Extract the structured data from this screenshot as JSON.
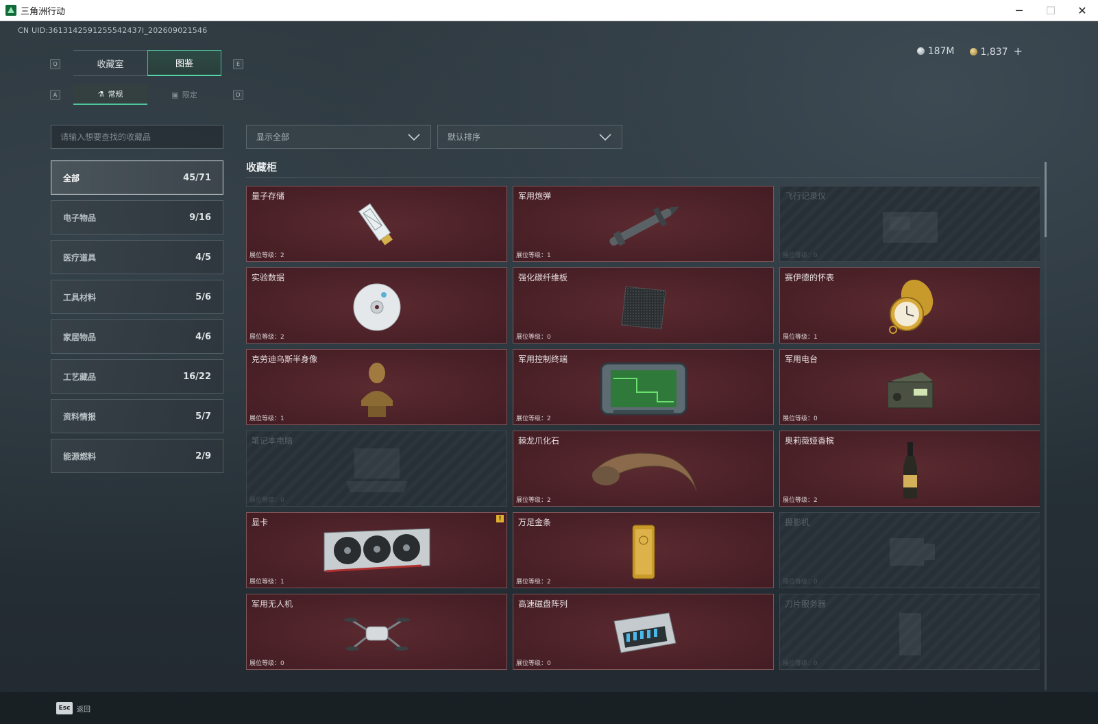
{
  "window": {
    "title": "三角洲行动",
    "minimize": "─",
    "maximize": "☐",
    "close": "✕"
  },
  "uid": "CN UID:3613142591255542437l_202609021546",
  "currency": {
    "silver": "187M",
    "gold": "1,837",
    "add": "+"
  },
  "tabs": {
    "key_left": "Q",
    "key_right": "E",
    "items": [
      {
        "label": "收藏室"
      },
      {
        "label": "图鉴"
      }
    ],
    "active_index": 1
  },
  "subtabs": {
    "key_left": "A",
    "key_right": "D",
    "items": [
      {
        "label": "常规",
        "icon": "flask-icon"
      },
      {
        "label": "限定",
        "icon": "image-icon"
      }
    ],
    "active_index": 0
  },
  "search": {
    "placeholder": "请输入想要查找的收藏品",
    "value": ""
  },
  "filters": {
    "show": "显示全部",
    "sort": "默认排序"
  },
  "categories": [
    {
      "label": "全部",
      "count": "45/71",
      "active": true
    },
    {
      "label": "电子物品",
      "count": "9/16"
    },
    {
      "label": "医疗道具",
      "count": "4/5"
    },
    {
      "label": "工具材料",
      "count": "5/6"
    },
    {
      "label": "家居物品",
      "count": "4/6"
    },
    {
      "label": "工艺藏品",
      "count": "16/22"
    },
    {
      "label": "资料情报",
      "count": "5/7"
    },
    {
      "label": "能源燃料",
      "count": "2/9"
    }
  ],
  "collection": {
    "title": "收藏柜",
    "level_prefix": "展位等级：",
    "items": [
      {
        "name": "量子存储",
        "level": "2",
        "locked": false,
        "icon": "usb-drive-icon"
      },
      {
        "name": "军用炮弹",
        "level": "1",
        "locked": false,
        "icon": "missile-icon"
      },
      {
        "name": "飞行记录仪",
        "level": "0",
        "locked": true,
        "icon": "flight-recorder-icon"
      },
      {
        "name": "实验数据",
        "level": "2",
        "locked": false,
        "icon": "disc-icon"
      },
      {
        "name": "强化碳纤维板",
        "level": "0",
        "locked": false,
        "icon": "carbon-plate-icon"
      },
      {
        "name": "赛伊德的怀表",
        "level": "1",
        "locked": false,
        "icon": "pocket-watch-icon"
      },
      {
        "name": "克劳迪乌斯半身像",
        "level": "1",
        "locked": false,
        "icon": "bust-icon"
      },
      {
        "name": "军用控制终端",
        "level": "2",
        "locked": false,
        "icon": "control-terminal-icon"
      },
      {
        "name": "军用电台",
        "level": "0",
        "locked": false,
        "icon": "radio-icon"
      },
      {
        "name": "笔记本电脑",
        "level": "0",
        "locked": true,
        "icon": "laptop-icon"
      },
      {
        "name": "棘龙爪化石",
        "level": "2",
        "locked": false,
        "icon": "claw-fossil-icon"
      },
      {
        "name": "奥莉薇娅香槟",
        "level": "2",
        "locked": false,
        "icon": "champagne-icon"
      },
      {
        "name": "显卡",
        "level": "1",
        "locked": false,
        "icon": "gpu-icon",
        "badge": "!"
      },
      {
        "name": "万足金条",
        "level": "2",
        "locked": false,
        "icon": "gold-bar-icon"
      },
      {
        "name": "摄影机",
        "level": "0",
        "locked": true,
        "icon": "camera-icon"
      },
      {
        "name": "军用无人机",
        "level": "0",
        "locked": false,
        "icon": "drone-icon"
      },
      {
        "name": "高速磁盘阵列",
        "level": "0",
        "locked": false,
        "icon": "disk-array-icon"
      },
      {
        "name": "刀片服务器",
        "level": "0",
        "locked": true,
        "icon": "blade-server-icon"
      }
    ]
  },
  "footer": {
    "key": "Esc",
    "label": "返回"
  }
}
